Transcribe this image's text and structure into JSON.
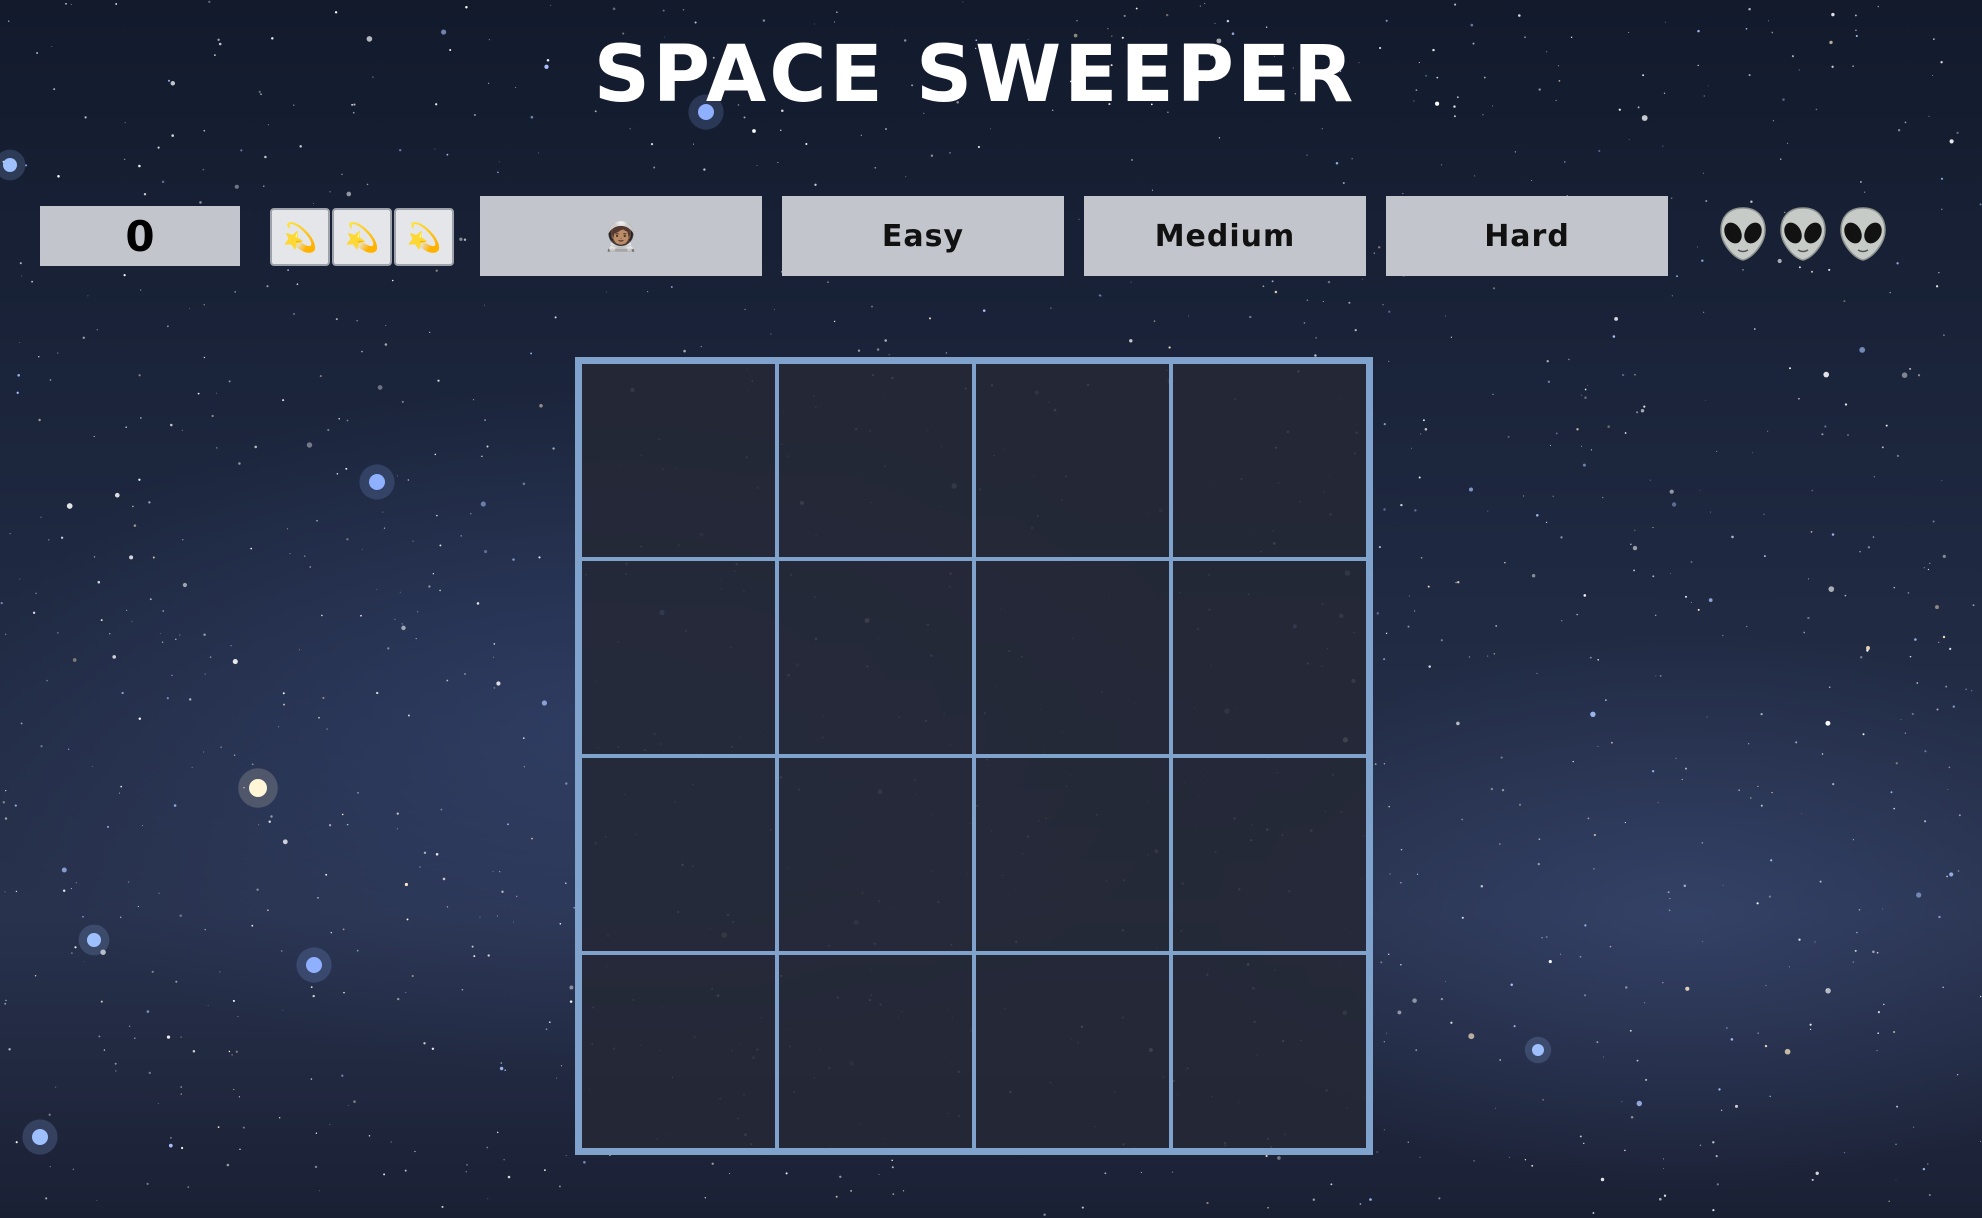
{
  "title": "SPACE SWEEPER",
  "counter": {
    "value": "0"
  },
  "lives": [
    "💫",
    "💫",
    "💫"
  ],
  "player": {
    "icon": "🧑🏽‍🚀"
  },
  "difficulty": {
    "easy": "Easy",
    "medium": "Medium",
    "hard": "Hard"
  },
  "aliens": [
    "alien-icon",
    "alien-icon",
    "alien-icon"
  ],
  "board": {
    "rows": 4,
    "cols": 4
  },
  "colors": {
    "panel": "#c2c5cb",
    "grid_line": "#7fa3cc",
    "cell": "#242836"
  }
}
